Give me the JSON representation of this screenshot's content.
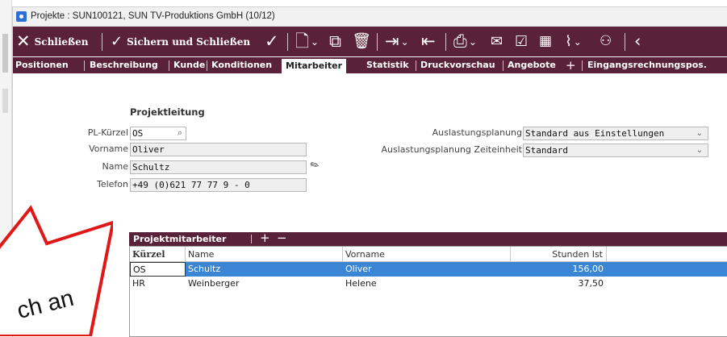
{
  "window": {
    "title": "Projekte : SUN100121, SUN TV-Produktions GmbH (10/12)"
  },
  "toolbar": {
    "close_label": "Schließen",
    "save_close_label": "Sichern und Schließen",
    "icons": [
      "close-icon",
      "save-close-icon",
      "checkmark-icon",
      "new-document-icon",
      "copy-document-icon",
      "delete-icon",
      "export-icon",
      "import-icon",
      "print-icon",
      "mail-icon",
      "task-icon",
      "calendar-icon",
      "attachment-icon",
      "teams-icon",
      "back-icon"
    ]
  },
  "tabs": [
    "Positionen",
    "Beschreibung",
    "Kunde",
    "Konditionen",
    "Mitarbeiter",
    "Statistik",
    "Druckvorschau",
    "Angebote",
    "Eingangsrechnungspos."
  ],
  "active_tab": "Mitarbeiter",
  "projektleitung": {
    "heading": "Projektleitung",
    "pl_kuerzel_label": "PL-Kürzel",
    "pl_kuerzel_value": "OS",
    "vorname_label": "Vorname",
    "vorname_value": "Oliver",
    "name_label": "Name",
    "name_value": "Schultz",
    "telefon_label": "Telefon",
    "telefon_value": "+49 (0)621 77 77 9 - 0",
    "auslastung_label": "Auslastungsplanung",
    "auslastung_value": "Standard aus Einstellungen",
    "auslastung_zeit_label": "Auslastungsplanung Zeiteinheit",
    "auslastung_zeit_value": "Standard"
  },
  "projektmitarbeiter": {
    "title": "Projektmitarbeiter",
    "columns": [
      "Kürzel",
      "Name",
      "Vorname",
      "Stunden Ist"
    ],
    "rows": [
      {
        "kuerzel": "OS",
        "name": "Schultz",
        "vorname": "Oliver",
        "stunden": "156,00"
      },
      {
        "kuerzel": "HR",
        "name": "Weinberger",
        "vorname": "Helene",
        "stunden": "37,50"
      }
    ]
  },
  "callout": {
    "text": "ch an",
    "color": "#e01818"
  },
  "colors": {
    "accent": "#59213a",
    "selection": "#3a86d4"
  }
}
